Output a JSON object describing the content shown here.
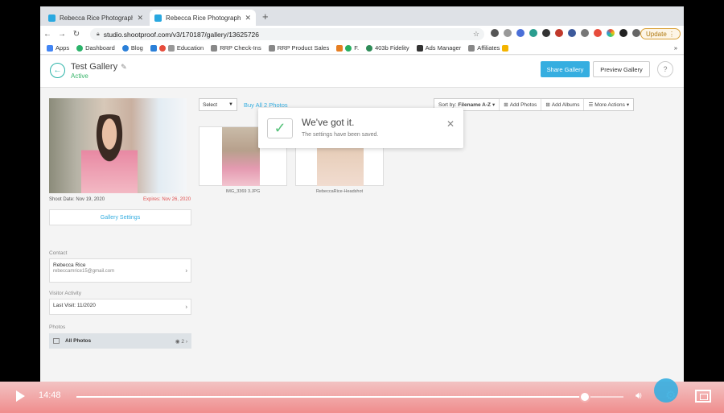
{
  "browser": {
    "tabs": [
      {
        "title": "Rebecca Rice Photography | Sh",
        "active": false
      },
      {
        "title": "Rebecca Rice Photography | Sh",
        "active": true
      }
    ],
    "new_tab_glyph": "+",
    "url": "studio.shootproof.com/v3/170187/gallery/13625726",
    "update_label": "Update",
    "bookmarks": [
      "Apps",
      "Dashboard",
      "Blog",
      "Education",
      "RRP Check-Ins",
      "RRP Product Sales",
      "F.",
      "403b Fidelity",
      "Ads Manager",
      "Affiliates"
    ],
    "bookmarks_more": "»"
  },
  "header": {
    "title": "Test Gallery",
    "status": "Active",
    "share_label": "Share Gallery",
    "preview_label": "Preview Gallery",
    "help_label": "?"
  },
  "sidebar": {
    "shoot_date": "Shoot Date: Nov 19, 2020",
    "expires": "Expires: Nov 26, 2020",
    "settings_label": "Gallery Settings",
    "contact_label": "Contact",
    "contact_name": "Rebecca Rice",
    "contact_email": "rebeccamrice15@gmail.com",
    "visitor_label": "Visitor Activity",
    "last_visit": "Last Visit: 11/2020",
    "photos_label": "Photos",
    "all_photos": "All Photos",
    "photo_count": "2"
  },
  "content": {
    "select_label": "Select",
    "buy_all": "Buy All 2 Photos",
    "sort_prefix": "Sort by:",
    "sort_value": "Filename A-Z",
    "add_photos": "Add Photos",
    "add_albums": "Add Albums",
    "more_actions": "More Actions",
    "photos": [
      {
        "caption": "IMG_3369 3.JPG"
      },
      {
        "caption": "RebeccaRice-Headshot"
      }
    ]
  },
  "toast": {
    "title": "We've got it.",
    "message": "The settings have been saved.",
    "close_glyph": "✕"
  },
  "video": {
    "time": "14:48",
    "progress": 0.93
  },
  "colors": {
    "accent": "#36aee0",
    "active_green": "#38b56a",
    "expires_red": "#e05050",
    "player_bar": "#f08d8d"
  }
}
